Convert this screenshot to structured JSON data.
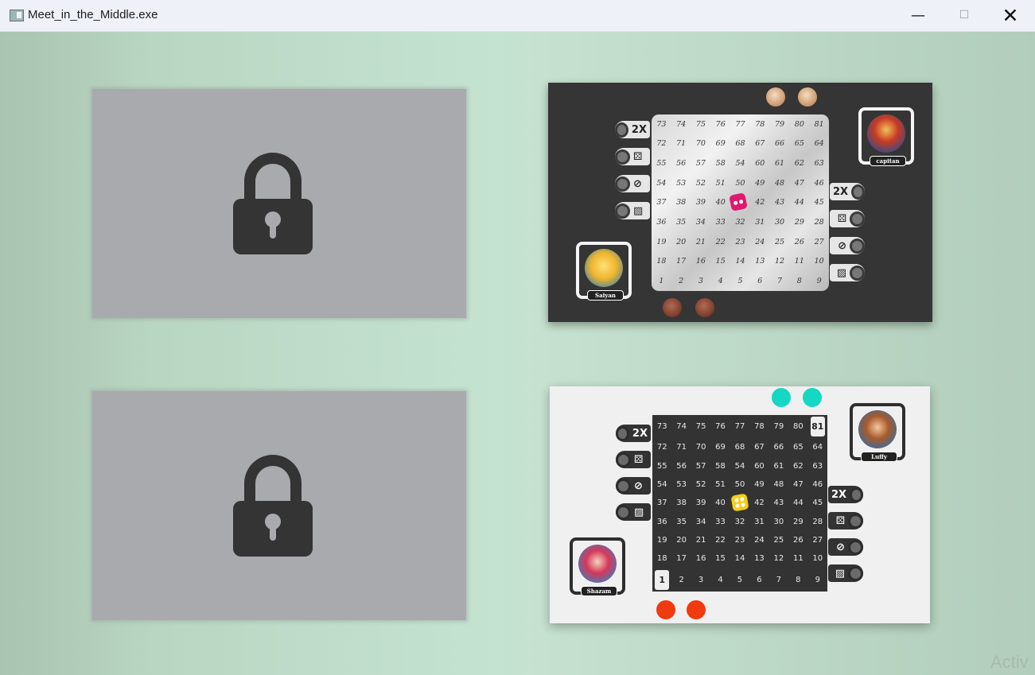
{
  "window": {
    "title": "Meet_in_the_Middle.exe",
    "minimize_icon": "—",
    "maximize_icon": "☐",
    "close_icon": "✕"
  },
  "colors": {
    "background": "#bcd9c6",
    "locked_tile": "#a9aaae",
    "lock": "#343434",
    "dark_board": "#353535",
    "light_board": "#f0f0f0",
    "cyan_pawn": "#14d8c4",
    "red_pawn": "#f03a10",
    "pink_die": "#e0196f",
    "yellow_die": "#f2cf17"
  },
  "levels": [
    {
      "id": "locked-1",
      "state": "locked",
      "icon": "padlock-icon"
    },
    {
      "id": "locked-2",
      "state": "locked",
      "icon": "padlock-icon"
    }
  ],
  "dark_board": {
    "rows": [
      [
        "73",
        "74",
        "75",
        "76",
        "77",
        "78",
        "79",
        "80",
        "81"
      ],
      [
        "72",
        "71",
        "70",
        "69",
        "68",
        "67",
        "66",
        "65",
        "64"
      ],
      [
        "55",
        "56",
        "57",
        "58",
        "54",
        "60",
        "61",
        "62",
        "63"
      ],
      [
        "54",
        "53",
        "52",
        "51",
        "50",
        "49",
        "48",
        "47",
        "46"
      ],
      [
        "37",
        "38",
        "39",
        "40",
        "",
        "42",
        "43",
        "44",
        "45"
      ],
      [
        "36",
        "35",
        "34",
        "33",
        "32",
        "31",
        "30",
        "29",
        "28"
      ],
      [
        "19",
        "20",
        "21",
        "22",
        "23",
        "24",
        "25",
        "26",
        "27"
      ],
      [
        "18",
        "17",
        "16",
        "15",
        "14",
        "13",
        "12",
        "11",
        "10"
      ],
      [
        "1",
        "2",
        "3",
        "4",
        "5",
        "6",
        "7",
        "8",
        "9"
      ]
    ],
    "left_powerups": [
      "2X",
      "dice-icon",
      "block-icon",
      "barrier-icon"
    ],
    "right_powerups": [
      "2X",
      "dice-icon",
      "block-icon",
      "barrier-icon"
    ],
    "player_bottom": "Saiyan",
    "player_top": "capitan"
  },
  "light_board": {
    "rows": [
      [
        "73",
        "74",
        "75",
        "76",
        "77",
        "78",
        "79",
        "80",
        "81"
      ],
      [
        "72",
        "71",
        "70",
        "69",
        "68",
        "67",
        "66",
        "65",
        "64"
      ],
      [
        "55",
        "56",
        "57",
        "58",
        "54",
        "60",
        "61",
        "62",
        "63"
      ],
      [
        "54",
        "53",
        "52",
        "51",
        "50",
        "49",
        "48",
        "47",
        "46"
      ],
      [
        "37",
        "38",
        "39",
        "40",
        "",
        "42",
        "43",
        "44",
        "45"
      ],
      [
        "36",
        "35",
        "34",
        "33",
        "32",
        "31",
        "30",
        "29",
        "28"
      ],
      [
        "19",
        "20",
        "21",
        "22",
        "23",
        "24",
        "25",
        "26",
        "27"
      ],
      [
        "18",
        "17",
        "16",
        "15",
        "14",
        "13",
        "12",
        "11",
        "10"
      ],
      [
        "1",
        "2",
        "3",
        "4",
        "5",
        "6",
        "7",
        "8",
        "9"
      ]
    ],
    "left_powerups": [
      "2X",
      "dice-icon",
      "block-icon",
      "barrier-icon"
    ],
    "right_powerups": [
      "2X",
      "dice-icon",
      "block-icon",
      "barrier-icon"
    ],
    "player_top": "Luffy",
    "player_bottom": "Shazam"
  },
  "watermark": "Activ"
}
